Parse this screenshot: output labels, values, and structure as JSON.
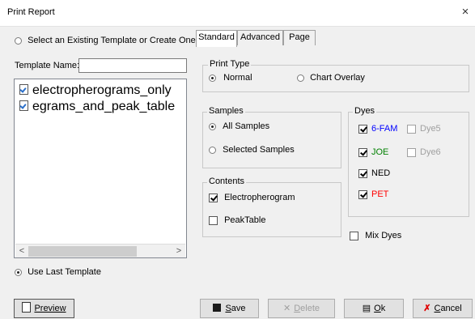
{
  "window": {
    "title": "Print Report",
    "close_glyph": "×"
  },
  "left": {
    "select_option": "Select an Existing Template or Create One",
    "template_name_label": "Template Name:",
    "template_name_value": "",
    "templates": [
      "electropherograms_only",
      "egrams_and_peak_table"
    ],
    "scroll_left": "<",
    "scroll_right": ">",
    "use_last_template": "Use Last Template",
    "preview_label": "Preview"
  },
  "tabs": [
    "Standard",
    "Advanced",
    "Page"
  ],
  "print_type": {
    "title": "Print Type",
    "normal": "Normal",
    "chart_overlay": "Chart Overlay",
    "selected": "normal"
  },
  "samples": {
    "title": "Samples",
    "all": "All Samples",
    "selected": "Selected Samples",
    "choice": "all"
  },
  "contents": {
    "title": "Contents",
    "electropherogram": "Electropherogram",
    "peak_table": "PeakTable"
  },
  "dyes": {
    "title": "Dyes",
    "items": [
      {
        "label": "6-FAM",
        "checked": true,
        "enabled": true,
        "color": "#0000ff"
      },
      {
        "label": "Dye5",
        "checked": false,
        "enabled": false,
        "color": "#a0a0a0"
      },
      {
        "label": "JOE",
        "checked": true,
        "enabled": true,
        "color": "#008000"
      },
      {
        "label": "Dye6",
        "checked": false,
        "enabled": false,
        "color": "#a0a0a0"
      },
      {
        "label": "NED",
        "checked": true,
        "enabled": true,
        "color": "#000000"
      },
      {
        "label": "PET",
        "checked": true,
        "enabled": true,
        "color": "#ff0000"
      }
    ],
    "mix_dyes": "Mix Dyes"
  },
  "buttons": {
    "save": {
      "underlined": "S",
      "rest": "ave"
    },
    "delete": {
      "underlined": "D",
      "rest": "elete"
    },
    "ok": {
      "underlined": "O",
      "rest": "k"
    },
    "cancel": {
      "underlined": "C",
      "rest": "ancel"
    }
  }
}
